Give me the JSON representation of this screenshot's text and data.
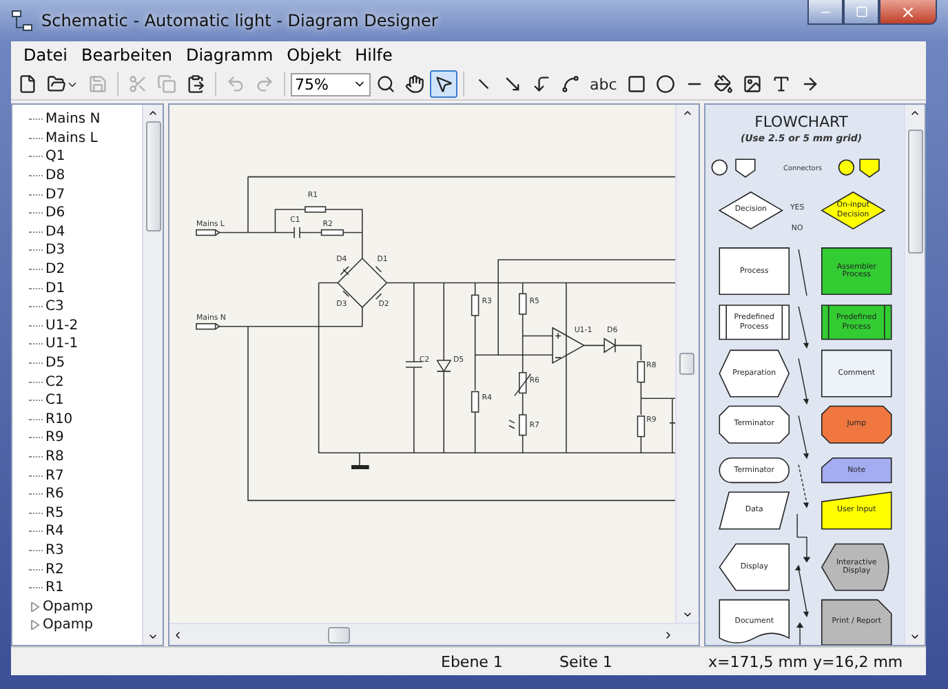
{
  "window": {
    "title": "Schematic - Automatic light - Diagram Designer"
  },
  "menu": [
    "Datei",
    "Bearbeiten",
    "Diagramm",
    "Objekt",
    "Hilfe"
  ],
  "toolbar": {
    "file_tools": [
      {
        "kind": "new",
        "disabled": false
      },
      {
        "kind": "open",
        "disabled": false
      },
      {
        "kind": "save",
        "disabled": true
      },
      {
        "kind": "cut",
        "disabled": true
      },
      {
        "kind": "copy",
        "disabled": true
      },
      {
        "kind": "paste",
        "disabled": false
      },
      {
        "kind": "undo",
        "disabled": true
      },
      {
        "kind": "redo",
        "disabled": true
      }
    ],
    "zoom": "75%",
    "draw_tools": [
      {
        "kind": "zoom",
        "selected": false
      },
      {
        "kind": "hand",
        "selected": false
      },
      {
        "kind": "select",
        "selected": true
      },
      {
        "kind": "line",
        "selected": false
      },
      {
        "kind": "arrow",
        "selected": false
      },
      {
        "kind": "connector",
        "selected": false
      },
      {
        "kind": "spline",
        "selected": false
      },
      {
        "kind": "text",
        "label": "abc",
        "selected": false
      },
      {
        "kind": "rect",
        "selected": false
      },
      {
        "kind": "ellipse",
        "selected": false
      },
      {
        "kind": "line-style",
        "selected": false
      },
      {
        "kind": "fill",
        "selected": false
      },
      {
        "kind": "picture",
        "selected": false
      },
      {
        "kind": "font",
        "selected": false
      },
      {
        "kind": "arrow-end",
        "selected": false
      }
    ]
  },
  "tree": [
    {
      "label": "Mains N",
      "kind": "leaf"
    },
    {
      "label": "Mains L",
      "kind": "leaf"
    },
    {
      "label": "Q1",
      "kind": "leaf"
    },
    {
      "label": "D8",
      "kind": "leaf"
    },
    {
      "label": "D7",
      "kind": "leaf"
    },
    {
      "label": "D6",
      "kind": "leaf"
    },
    {
      "label": "D4",
      "kind": "leaf"
    },
    {
      "label": "D3",
      "kind": "leaf"
    },
    {
      "label": "D2",
      "kind": "leaf"
    },
    {
      "label": "D1",
      "kind": "leaf"
    },
    {
      "label": "C3",
      "kind": "leaf"
    },
    {
      "label": "U1-2",
      "kind": "leaf"
    },
    {
      "label": "U1-1",
      "kind": "leaf"
    },
    {
      "label": "D5",
      "kind": "leaf"
    },
    {
      "label": "C2",
      "kind": "leaf"
    },
    {
      "label": "C1",
      "kind": "leaf"
    },
    {
      "label": "R10",
      "kind": "leaf"
    },
    {
      "label": "R9",
      "kind": "leaf"
    },
    {
      "label": "R8",
      "kind": "leaf"
    },
    {
      "label": "R7",
      "kind": "leaf"
    },
    {
      "label": "R6",
      "kind": "leaf"
    },
    {
      "label": "R5",
      "kind": "leaf"
    },
    {
      "label": "R4",
      "kind": "leaf"
    },
    {
      "label": "R3",
      "kind": "leaf"
    },
    {
      "label": "R2",
      "kind": "leaf"
    },
    {
      "label": "R1",
      "kind": "leaf"
    },
    {
      "label": "Opamp",
      "kind": "group",
      "expanded": false
    },
    {
      "label": "Opamp",
      "kind": "group",
      "expanded": false
    }
  ],
  "schematic": {
    "labels": [
      "Mains L",
      "Mains N",
      "R1",
      "C1",
      "R2",
      "D4",
      "D1",
      "D3",
      "D2",
      "C2",
      "D5",
      "R3",
      "R5",
      "R4",
      "R6",
      "R7",
      "U1-1",
      "D6",
      "R8",
      "R9"
    ]
  },
  "palette": {
    "title": "FLOWCHART",
    "subtitle": "(Use 2.5 or 5 mm grid)",
    "connectors": {
      "label": "Connectors",
      "shapes": [
        {
          "kind": "circle",
          "color": "#ffffff"
        },
        {
          "kind": "offpage",
          "color": "#ffffff"
        },
        {
          "kind": "circle",
          "color": "#ffff00"
        },
        {
          "kind": "offpage",
          "color": "#ffff00"
        }
      ]
    },
    "yes": "YES",
    "no": "NO",
    "rows": [
      {
        "left": {
          "kind": "decision",
          "label": "Decision",
          "color": "#ffffff"
        },
        "right": {
          "kind": "decision",
          "label": "On-input Decision",
          "color": "#ffff00"
        }
      },
      {
        "left": {
          "kind": "process",
          "label": "Process",
          "color": "#ffffff"
        },
        "right": {
          "kind": "process",
          "label": "Assembler Process",
          "color": "#33cc33"
        }
      },
      {
        "left": {
          "kind": "predefined",
          "label": "Predefined Process",
          "color": "#ffffff"
        },
        "right": {
          "kind": "predefined",
          "label": "Predefined Process",
          "color": "#33cc33"
        }
      },
      {
        "left": {
          "kind": "preparation",
          "label": "Preparation",
          "color": "#ffffff"
        },
        "right": {
          "kind": "process",
          "label": "Comment",
          "color": "#eef2f9"
        }
      },
      {
        "left": {
          "kind": "terminator",
          "label": "Terminator",
          "color": "#ffffff"
        },
        "right": {
          "kind": "jump",
          "label": "Jump",
          "color": "#f07840"
        }
      },
      {
        "left": {
          "kind": "rounded",
          "label": "Terminator",
          "color": "#ffffff"
        },
        "right": {
          "kind": "note",
          "label": "Note",
          "color": "#a4acf2"
        }
      },
      {
        "left": {
          "kind": "data",
          "label": "Data",
          "color": "#ffffff"
        },
        "right": {
          "kind": "user-input",
          "label": "User Input",
          "color": "#ffff00"
        }
      },
      {
        "left": {
          "kind": "display",
          "label": "Display",
          "color": "#ffffff"
        },
        "right": {
          "kind": "interactive",
          "label": "Interactive Display",
          "color": "#b8b8b8"
        }
      },
      {
        "left": {
          "kind": "document",
          "label": "Document",
          "color": "#ffffff"
        },
        "right": {
          "kind": "print",
          "label": "Print / Report",
          "color": "#b8b8b8"
        }
      }
    ]
  },
  "status_bar": {
    "layer": "Ebene 1",
    "page": "Seite 1",
    "x": "x=171,5 mm",
    "y": "y=16,2 mm"
  }
}
